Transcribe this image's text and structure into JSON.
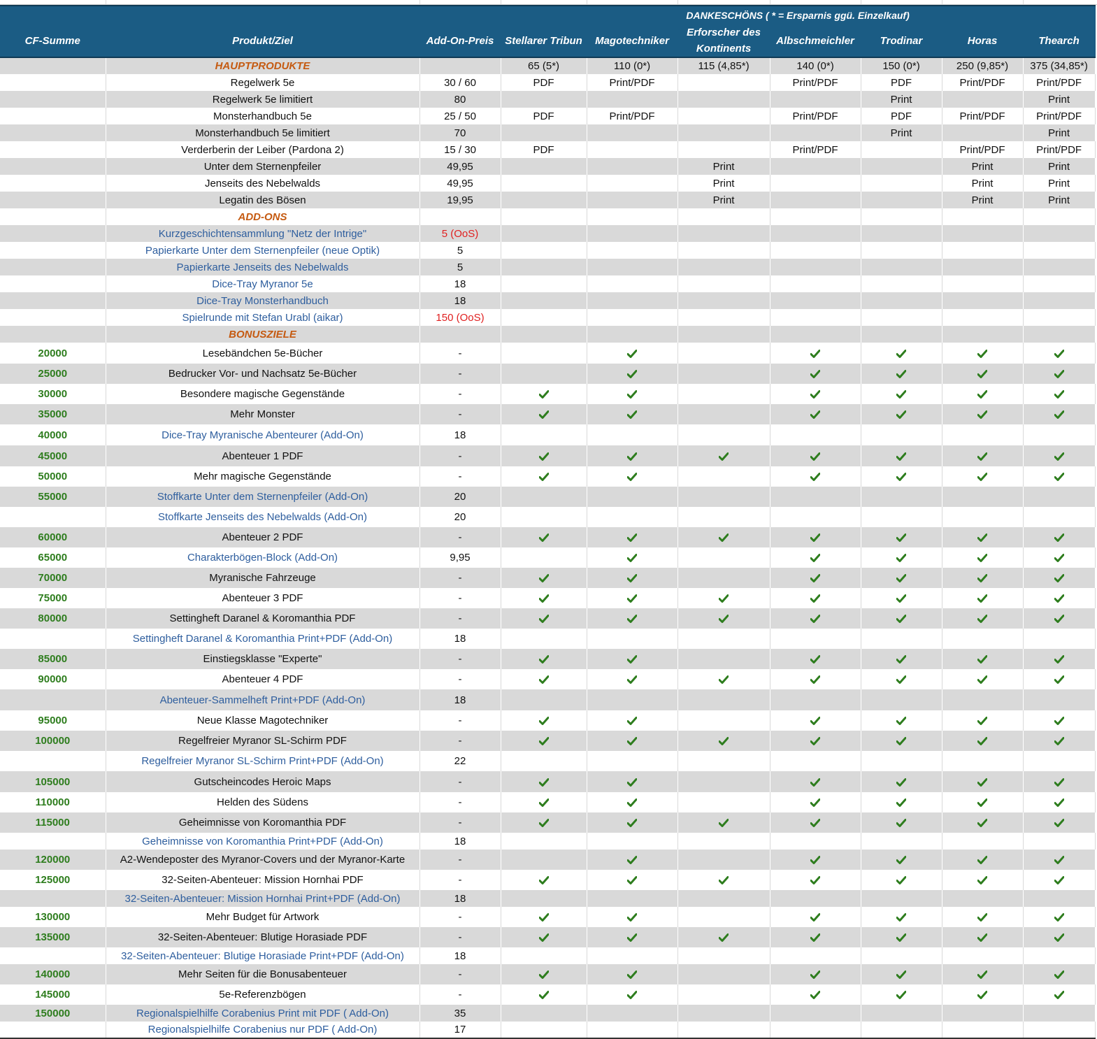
{
  "header": {
    "group_title": "DANKESCHÖNS ( * = Ersparnis ggü. Einzelkauf)",
    "columns": [
      "CF-Summe",
      "Produkt/Ziel",
      "Add-On-Preis",
      "Stellarer Tribun",
      "Magotechniker",
      "Erforscher des Kontinents",
      "Albschmeichler",
      "Trodinar",
      "Horas",
      "Thearch"
    ]
  },
  "colors": {
    "header_bg": "#1b5c84",
    "section": "#c55a11",
    "addon_text": "#2e5e9e",
    "cf_text": "#2e7d1e",
    "oos_text": "#e02020",
    "check": "#2e7d1e",
    "band": "#d9d9d9"
  },
  "check_icon": "check-icon",
  "rows": [
    {
      "h": 24,
      "bg": "g",
      "cf": "",
      "name": "HAUPTPRODUKTE",
      "type": "sec",
      "price": "",
      "cells": [
        "65 (5*)",
        "110 (0*)",
        "115 (4,85*)",
        "140 (0*)",
        "150 (0*)",
        "250 (9,85*)",
        "375 (34,85*)"
      ]
    },
    {
      "h": 24,
      "bg": "w",
      "cf": "",
      "name": "Regelwerk 5e",
      "type": "plain",
      "price": "30 / 60",
      "cells": [
        "PDF",
        "Print/PDF",
        "",
        "Print/PDF",
        "PDF",
        "Print/PDF",
        "Print/PDF"
      ]
    },
    {
      "h": 24,
      "bg": "g",
      "cf": "",
      "name": "Regelwerk 5e limitiert",
      "type": "plain",
      "price": "80",
      "cells": [
        "",
        "",
        "",
        "",
        "Print",
        "",
        "Print"
      ]
    },
    {
      "h": 24,
      "bg": "w",
      "cf": "",
      "name": "Monsterhandbuch 5e",
      "type": "plain",
      "price": "25 / 50",
      "cells": [
        "PDF",
        "Print/PDF",
        "",
        "Print/PDF",
        "PDF",
        "Print/PDF",
        "Print/PDF"
      ]
    },
    {
      "h": 24,
      "bg": "g",
      "cf": "",
      "name": "Monsterhandbuch 5e limitiert",
      "type": "plain",
      "price": "70",
      "cells": [
        "",
        "",
        "",
        "",
        "Print",
        "",
        "Print"
      ]
    },
    {
      "h": 24,
      "bg": "w",
      "cf": "",
      "name": "Verderberin der Leiber (Pardona 2)",
      "type": "plain",
      "price": "15 / 30",
      "cells": [
        "PDF",
        "",
        "",
        "Print/PDF",
        "",
        "Print/PDF",
        "Print/PDF"
      ]
    },
    {
      "h": 24,
      "bg": "g",
      "cf": "",
      "name": "Unter dem Sternenpfeiler",
      "type": "plain",
      "price": "49,95",
      "cells": [
        "",
        "",
        "Print",
        "",
        "",
        "Print",
        "Print"
      ]
    },
    {
      "h": 24,
      "bg": "w",
      "cf": "",
      "name": "Jenseits des Nebelwalds",
      "type": "plain",
      "price": "49,95",
      "cells": [
        "",
        "",
        "Print",
        "",
        "",
        "Print",
        "Print"
      ]
    },
    {
      "h": 24,
      "bg": "g",
      "cf": "",
      "name": "Legatin des Bösen",
      "type": "plain",
      "price": "19,95",
      "cells": [
        "",
        "",
        "Print",
        "",
        "",
        "Print",
        "Print"
      ]
    },
    {
      "h": 24,
      "bg": "w",
      "cf": "",
      "name": "ADD-ONS",
      "type": "sec",
      "price": "",
      "cells": [
        "",
        "",
        "",
        "",
        "",
        "",
        ""
      ]
    },
    {
      "h": 24,
      "bg": "g",
      "cf": "",
      "name": "Kurzgeschichtensammlung \"Netz der Intrige\"",
      "type": "addon",
      "price": "5 (OoS)",
      "oos": true,
      "cells": [
        "",
        "",
        "",
        "",
        "",
        "",
        ""
      ]
    },
    {
      "h": 24,
      "bg": "w",
      "cf": "",
      "name": "Papierkarte Unter dem Sternenpfeiler (neue Optik)",
      "type": "addon",
      "price": "5",
      "cells": [
        "",
        "",
        "",
        "",
        "",
        "",
        ""
      ]
    },
    {
      "h": 24,
      "bg": "g",
      "cf": "",
      "name": "Papierkarte Jenseits des Nebelwalds",
      "type": "addon",
      "price": "5",
      "cells": [
        "",
        "",
        "",
        "",
        "",
        "",
        ""
      ]
    },
    {
      "h": 24,
      "bg": "w",
      "cf": "",
      "name": "Dice-Tray Myranor 5e",
      "type": "addon",
      "price": "18",
      "cells": [
        "",
        "",
        "",
        "",
        "",
        "",
        ""
      ]
    },
    {
      "h": 24,
      "bg": "g",
      "cf": "",
      "name": "Dice-Tray Monsterhandbuch",
      "type": "addon",
      "price": "18",
      "cells": [
        "",
        "",
        "",
        "",
        "",
        "",
        ""
      ]
    },
    {
      "h": 24,
      "bg": "w",
      "cf": "",
      "name": "Spielrunde mit Stefan Urabl (aikar)",
      "type": "addon",
      "price": "150 (OoS)",
      "oos": true,
      "cells": [
        "",
        "",
        "",
        "",
        "",
        "",
        ""
      ]
    },
    {
      "h": 24,
      "bg": "g",
      "cf": "",
      "name": "BONUSZIELE",
      "type": "sec",
      "price": "",
      "cells": [
        "",
        "",
        "",
        "",
        "",
        "",
        ""
      ]
    },
    {
      "h": 30,
      "bg": "w",
      "cf": "20000",
      "name": "Lesebändchen 5e-Bücher",
      "type": "plain",
      "price": "-",
      "cells": [
        "",
        "✓",
        "",
        "✓",
        "✓",
        "✓",
        "✓"
      ]
    },
    {
      "h": 29,
      "bg": "g",
      "cf": "25000",
      "name": "Bedrucker Vor- und Nachsatz 5e-Bücher",
      "type": "plain",
      "price": "-",
      "cells": [
        "",
        "✓",
        "",
        "✓",
        "✓",
        "✓",
        "✓"
      ]
    },
    {
      "h": 29,
      "bg": "w",
      "cf": "30000",
      "name": "Besondere magische Gegenstände",
      "type": "plain",
      "price": "-",
      "cells": [
        "✓",
        "✓",
        "",
        "✓",
        "✓",
        "✓",
        "✓"
      ]
    },
    {
      "h": 29,
      "bg": "g",
      "cf": "35000",
      "name": "Mehr Monster",
      "type": "plain",
      "price": "-",
      "cells": [
        "✓",
        "✓",
        "",
        "✓",
        "✓",
        "✓",
        "✓"
      ]
    },
    {
      "h": 30,
      "bg": "w",
      "cf": "40000",
      "name": "Dice-Tray Myranische Abenteurer (Add-On)",
      "type": "addon",
      "price": "18",
      "cells": [
        "",
        "",
        "",
        "",
        "",
        "",
        ""
      ]
    },
    {
      "h": 30,
      "bg": "g",
      "cf": "45000",
      "name": "Abenteuer 1 PDF",
      "type": "plain",
      "price": "-",
      "cells": [
        "✓",
        "✓",
        "✓",
        "✓",
        "✓",
        "✓",
        "✓"
      ]
    },
    {
      "h": 29,
      "bg": "w",
      "cf": "50000",
      "name": "Mehr magische Gegenstände",
      "type": "plain",
      "price": "-",
      "cells": [
        "✓",
        "✓",
        "",
        "✓",
        "✓",
        "✓",
        "✓"
      ]
    },
    {
      "h": 29,
      "bg": "g",
      "cf": "55000",
      "name": "Stoffkarte Unter dem Sternenpfeiler (Add-On)",
      "type": "addon",
      "price": "20",
      "cells": [
        "",
        "",
        "",
        "",
        "",
        "",
        ""
      ]
    },
    {
      "h": 29,
      "bg": "w",
      "cf": "",
      "name": "Stoffkarte Jenseits des Nebelwalds (Add-On)",
      "type": "addon",
      "price": "20",
      "cells": [
        "",
        "",
        "",
        "",
        "",
        "",
        ""
      ]
    },
    {
      "h": 29,
      "bg": "g",
      "cf": "60000",
      "name": "Abenteuer 2 PDF",
      "type": "plain",
      "price": "-",
      "cells": [
        "✓",
        "✓",
        "✓",
        "✓",
        "✓",
        "✓",
        "✓"
      ]
    },
    {
      "h": 29,
      "bg": "w",
      "cf": "65000",
      "name": "Charakterbögen-Block (Add-On)",
      "type": "addon",
      "price": "9,95",
      "cells": [
        "",
        "✓",
        "",
        "✓",
        "✓",
        "✓",
        "✓"
      ]
    },
    {
      "h": 29,
      "bg": "g",
      "cf": "70000",
      "name": "Myranische Fahrzeuge",
      "type": "plain",
      "price": "-",
      "cells": [
        "✓",
        "✓",
        "",
        "✓",
        "✓",
        "✓",
        "✓"
      ]
    },
    {
      "h": 29,
      "bg": "w",
      "cf": "75000",
      "name": "Abenteuer 3 PDF",
      "type": "plain",
      "price": "-",
      "cells": [
        "✓",
        "✓",
        "✓",
        "✓",
        "✓",
        "✓",
        "✓"
      ]
    },
    {
      "h": 29,
      "bg": "g",
      "cf": "80000",
      "name": "Settingheft Daranel & Koromanthia PDF",
      "type": "plain",
      "price": "-",
      "cells": [
        "✓",
        "✓",
        "✓",
        "✓",
        "✓",
        "✓",
        "✓"
      ]
    },
    {
      "h": 29,
      "bg": "w",
      "cf": "",
      "name": "Settingheft Daranel & Koromanthia Print+PDF (Add-On)",
      "type": "addon",
      "price": "18",
      "cells": [
        "",
        "",
        "",
        "",
        "",
        "",
        ""
      ]
    },
    {
      "h": 29,
      "bg": "g",
      "cf": "85000",
      "name": "Einstiegsklasse \"Experte\"",
      "type": "plain",
      "price": "-",
      "cells": [
        "✓",
        "✓",
        "",
        "✓",
        "✓",
        "✓",
        "✓"
      ]
    },
    {
      "h": 29,
      "bg": "w",
      "cf": "90000",
      "name": "Abenteuer 4 PDF",
      "type": "plain",
      "price": "-",
      "cells": [
        "✓",
        "✓",
        "✓",
        "✓",
        "✓",
        "✓",
        "✓"
      ]
    },
    {
      "h": 30,
      "bg": "g",
      "cf": "",
      "name": "Abenteuer-Sammelheft Print+PDF (Add-On)",
      "type": "addon",
      "price": "18",
      "cells": [
        "",
        "",
        "",
        "",
        "",
        "",
        ""
      ]
    },
    {
      "h": 29,
      "bg": "w",
      "cf": "95000",
      "name": "Neue Klasse Magotechniker",
      "type": "plain",
      "price": "-",
      "cells": [
        "✓",
        "✓",
        "",
        "✓",
        "✓",
        "✓",
        "✓"
      ]
    },
    {
      "h": 29,
      "bg": "g",
      "cf": "100000",
      "name": "Regelfreier Myranor SL-Schirm PDF",
      "type": "plain",
      "price": "-",
      "cells": [
        "✓",
        "✓",
        "✓",
        "✓",
        "✓",
        "✓",
        "✓"
      ]
    },
    {
      "h": 29,
      "bg": "w",
      "cf": "",
      "name": "Regelfreier Myranor SL-Schirm Print+PDF (Add-On)",
      "type": "addon",
      "price": "22",
      "cells": [
        "",
        "",
        "",
        "",
        "",
        "",
        ""
      ]
    },
    {
      "h": 30,
      "bg": "g",
      "cf": "105000",
      "name": "Gutscheincodes Heroic Maps",
      "type": "plain",
      "price": "-",
      "cells": [
        "✓",
        "✓",
        "",
        "✓",
        "✓",
        "✓",
        "✓"
      ]
    },
    {
      "h": 29,
      "bg": "w",
      "cf": "110000",
      "name": "Helden des Südens",
      "type": "plain",
      "price": "-",
      "cells": [
        "✓",
        "✓",
        "",
        "✓",
        "✓",
        "✓",
        "✓"
      ]
    },
    {
      "h": 29,
      "bg": "g",
      "cf": "115000",
      "name": "Geheimnisse von Koromanthia PDF",
      "type": "plain",
      "price": "-",
      "cells": [
        "✓",
        "✓",
        "✓",
        "✓",
        "✓",
        "✓",
        "✓"
      ]
    },
    {
      "h": 24,
      "bg": "w",
      "cf": "",
      "name": "Geheimnisse von Koromanthia Print+PDF (Add-On)",
      "type": "addon",
      "price": "18",
      "cells": [
        "",
        "",
        "",
        "",
        "",
        "",
        ""
      ]
    },
    {
      "h": 29,
      "bg": "g",
      "cf": "120000",
      "name": "A2-Wendeposter des Myranor-Covers und der Myranor-Karte",
      "type": "plain",
      "price": "-",
      "cells": [
        "",
        "✓",
        "",
        "✓",
        "✓",
        "✓",
        "✓"
      ]
    },
    {
      "h": 29,
      "bg": "w",
      "cf": "125000",
      "name": "32-Seiten-Abenteuer: Mission Hornhai PDF",
      "type": "plain",
      "price": "-",
      "cells": [
        "✓",
        "✓",
        "✓",
        "✓",
        "✓",
        "✓",
        "✓"
      ]
    },
    {
      "h": 24,
      "bg": "g",
      "cf": "",
      "name": "32-Seiten-Abenteuer: Mission Hornhai Print+PDF (Add-On)",
      "type": "addon",
      "price": "18",
      "cells": [
        "",
        "",
        "",
        "",
        "",
        "",
        ""
      ]
    },
    {
      "h": 29,
      "bg": "w",
      "cf": "130000",
      "name": "Mehr Budget für Artwork",
      "type": "plain",
      "price": "-",
      "cells": [
        "✓",
        "✓",
        "",
        "✓",
        "✓",
        "✓",
        "✓"
      ]
    },
    {
      "h": 29,
      "bg": "g",
      "cf": "135000",
      "name": "32-Seiten-Abenteuer: Blutige Horasiade PDF",
      "type": "plain",
      "price": "-",
      "cells": [
        "✓",
        "✓",
        "✓",
        "✓",
        "✓",
        "✓",
        "✓"
      ]
    },
    {
      "h": 24,
      "bg": "w",
      "cf": "",
      "name": "32-Seiten-Abenteuer: Blutige Horasiade Print+PDF (Add-On)",
      "type": "addon",
      "price": "18",
      "cells": [
        "",
        "",
        "",
        "",
        "",
        "",
        ""
      ]
    },
    {
      "h": 29,
      "bg": "g",
      "cf": "140000",
      "name": "Mehr Seiten für die Bonusabenteuer",
      "type": "plain",
      "price": "-",
      "cells": [
        "✓",
        "✓",
        "",
        "✓",
        "✓",
        "✓",
        "✓"
      ]
    },
    {
      "h": 29,
      "bg": "w",
      "cf": "145000",
      "name": "5e-Referenzbögen",
      "type": "plain",
      "price": "-",
      "cells": [
        "✓",
        "✓",
        "",
        "✓",
        "✓",
        "✓",
        "✓"
      ]
    },
    {
      "h": 24,
      "bg": "g",
      "cf": "150000",
      "name": "Regionalspielhilfe Corabenius Print mit PDF ( Add-On)",
      "type": "addon",
      "price": "35",
      "cells": [
        "",
        "",
        "",
        "",
        "",
        "",
        ""
      ]
    },
    {
      "h": 24,
      "bg": "w",
      "cf": "",
      "name": "Regionalspielhilfe Corabenius nur PDF ( Add-On)",
      "type": "addon",
      "price": "17",
      "cells": [
        "",
        "",
        "",
        "",
        "",
        "",
        ""
      ]
    }
  ]
}
